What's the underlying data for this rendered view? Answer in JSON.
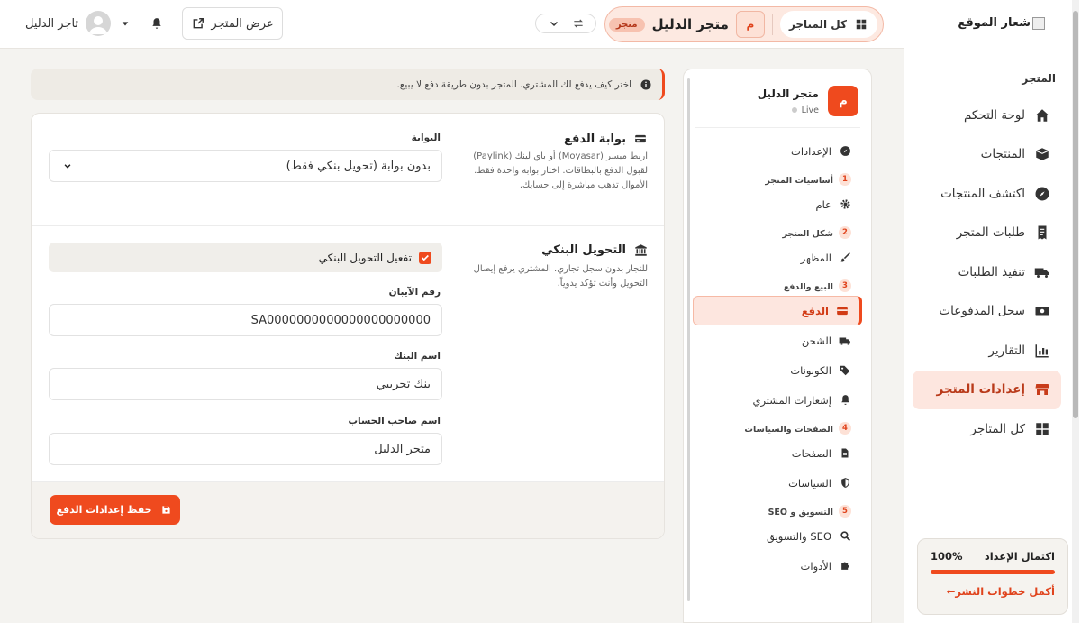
{
  "sidebar": {
    "logo_text": "شعار الموقع",
    "section_label": "المتجر",
    "items": [
      {
        "label": "لوحة التحكم",
        "icon": "home-icon"
      },
      {
        "label": "المنتجات",
        "icon": "box-icon"
      },
      {
        "label": "اكتشف المنتجات",
        "icon": "compass-icon"
      },
      {
        "label": "طلبات المتجر",
        "icon": "receipt-icon"
      },
      {
        "label": "تنفيذ الطلبات",
        "icon": "truck-icon"
      },
      {
        "label": "سجل المدفوعات",
        "icon": "money-icon"
      },
      {
        "label": "التقارير",
        "icon": "chart-icon"
      },
      {
        "label": "إعدادات المتجر",
        "icon": "store-icon",
        "active": true
      },
      {
        "label": "كل المتاجر",
        "icon": "grid-icon"
      }
    ],
    "progress": {
      "title": "اكتمال الإعداد",
      "percent_label": "100%",
      "value": 1.0,
      "link": "أكمل خطوات النشر←"
    }
  },
  "topbar": {
    "all_stores": "كل المتاجر",
    "store_avatar": "م",
    "store_name": "متجر الدليل",
    "store_badge": "متجر",
    "view_store": "عرض المتجر",
    "user_name": "تاجر الدليل"
  },
  "settings_nav": {
    "store_name": "متجر الدليل",
    "store_avatar": "م",
    "status": "Live",
    "settings": "الإعدادات",
    "groups": [
      {
        "num": "1",
        "label": "أساسيات المتجر",
        "items": [
          {
            "label": "عام",
            "icon": "gear-icon"
          }
        ]
      },
      {
        "num": "2",
        "label": "شكل المتجر",
        "items": [
          {
            "label": "المظهر",
            "icon": "brush-icon"
          }
        ]
      },
      {
        "num": "3",
        "label": "البيع والدفع",
        "items": [
          {
            "label": "الدفع",
            "icon": "card-icon",
            "active": true
          },
          {
            "label": "الشحن",
            "icon": "truck-icon"
          },
          {
            "label": "الكوبونات",
            "icon": "tags-icon"
          },
          {
            "label": "إشعارات المشتري",
            "icon": "bell-icon"
          }
        ]
      },
      {
        "num": "4",
        "label": "الصفحات والسياسات",
        "items": [
          {
            "label": "الصفحات",
            "icon": "file-icon"
          },
          {
            "label": "السياسات",
            "icon": "shield-icon"
          }
        ]
      },
      {
        "num": "5",
        "label": "التسويق و SEO",
        "items": [
          {
            "label": "SEO والتسويق",
            "icon": "search-icon"
          },
          {
            "label": "الأدوات",
            "icon": "puzzle-icon"
          }
        ]
      }
    ]
  },
  "content": {
    "notice": "اختر كيف يدفع لك المشتري. المتجر بدون طريقة دفع لا يبيع.",
    "gateway": {
      "title": "بوابة الدفع",
      "desc": "اربط ميسر (Moyasar) أو باي لينك (Paylink) لقبول الدفع بالبطاقات. اختار بوابة واحدة فقط. الأموال تذهب مباشرة إلى حسابك.",
      "field_label": "البوابة",
      "selected": "بدون بوابة (تحويل بنكي فقط)"
    },
    "bank": {
      "title": "التحويل البنكي",
      "desc": "للتجار بدون سجل تجاري. المشتري يرفع إيصال التحويل وأنت تؤكد يدوياً.",
      "enable_label": "تفعيل التحويل البنكي",
      "iban_label": "رقم الآيبان",
      "iban_value": "SA0000000000000000000000",
      "bank_label": "اسم البنك",
      "bank_value": "بنك تجريبي",
      "holder_label": "اسم صاحب الحساب",
      "holder_value": "متجر الدليل"
    },
    "save_button": "حفظ إعدادات الدفع"
  },
  "colors": {
    "accent": "#ef4a1e",
    "accent_soft": "#fde6df"
  }
}
